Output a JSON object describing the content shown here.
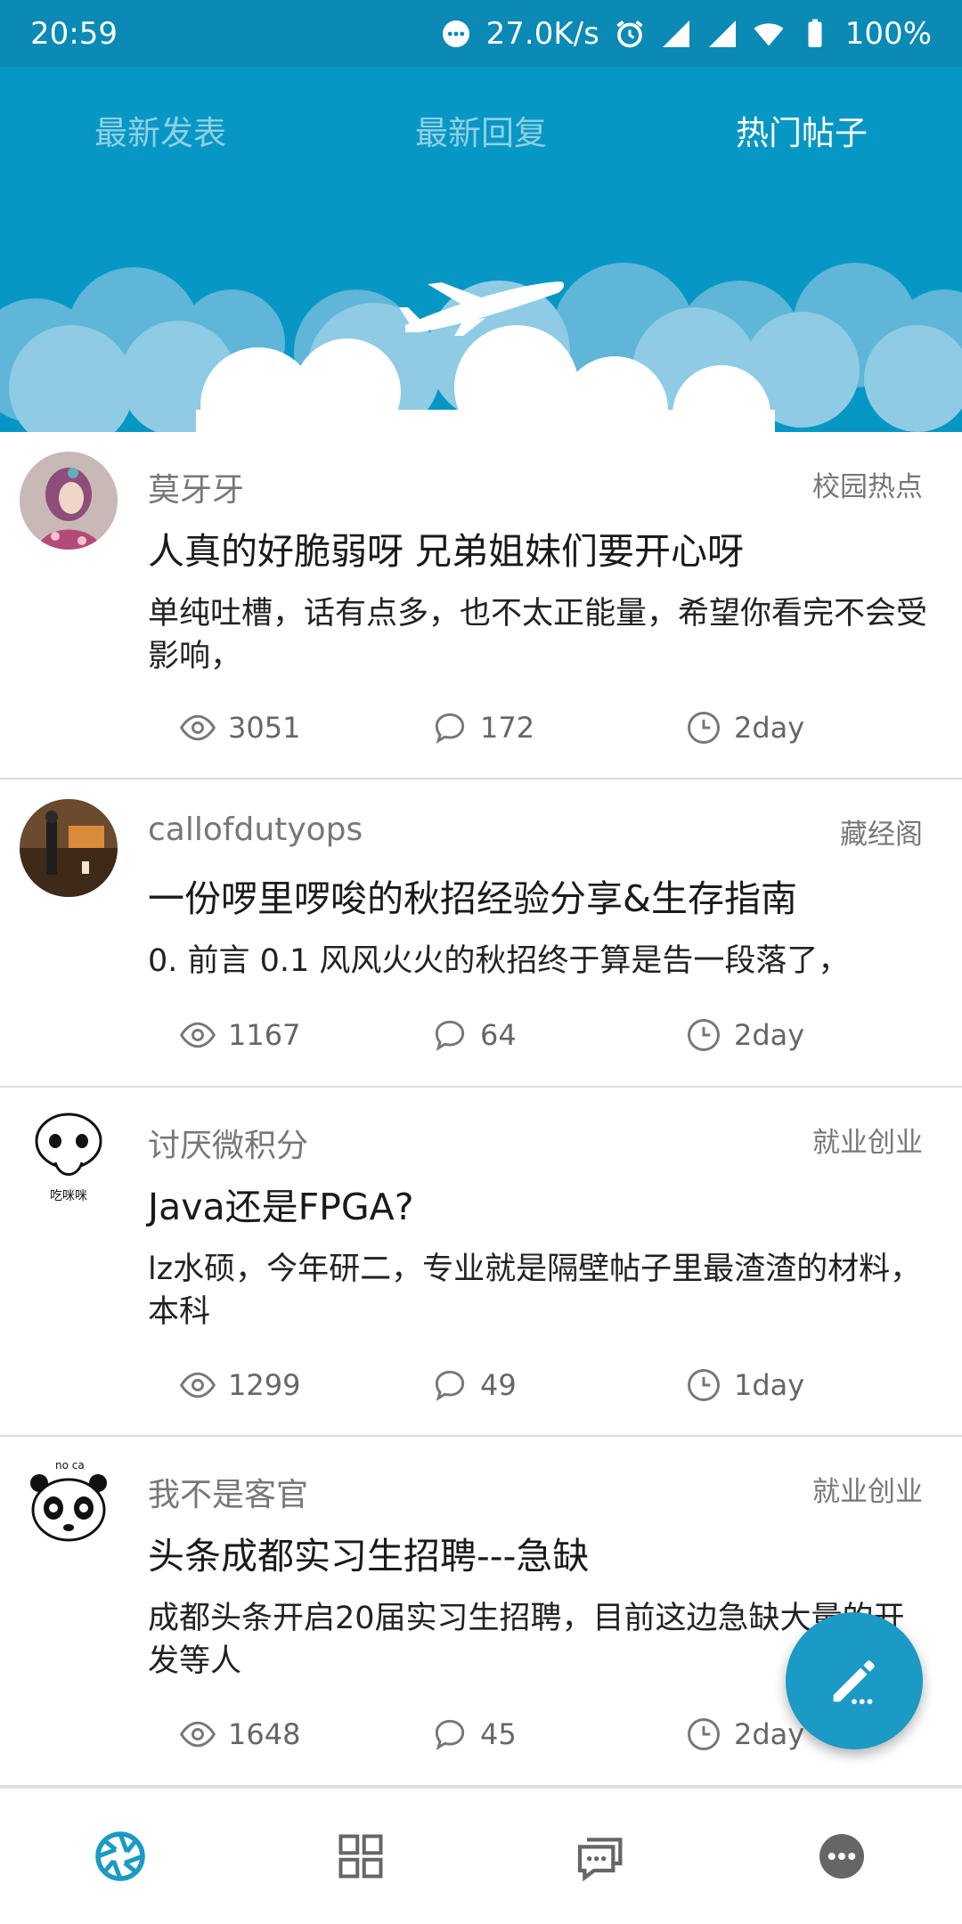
{
  "status_bar": {
    "time": "20:59",
    "net_speed": "27.0K/s",
    "battery": "100%"
  },
  "tabs": [
    {
      "label": "最新发表",
      "active": false
    },
    {
      "label": "最新回复",
      "active": false
    },
    {
      "label": "热门帖子",
      "active": true
    }
  ],
  "posts": [
    {
      "author": "莫牙牙",
      "forum": "校园热点",
      "title": "人真的好脆弱呀 兄弟姐妹们要开心呀",
      "summary": "单纯吐槽，话有点多，也不太正能量，希望你看完不会受影响，",
      "views": "3051",
      "comments": "172",
      "time": "2day"
    },
    {
      "author": "callofdutyops",
      "forum": "藏经阁",
      "title": "一份啰里啰唆的秋招经验分享&生存指南",
      "summary": "0. 前言  0.1 风风火火的秋招终于算是告一段落了，",
      "views": "1167",
      "comments": "64",
      "time": "2day"
    },
    {
      "author": "讨厌微积分",
      "forum": "就业创业",
      "title": "Java还是FPGA?",
      "summary": "lz水硕，今年研二，专业就是隔壁帖子里最渣渣的材料，本科",
      "views": "1299",
      "comments": "49",
      "time": "1day",
      "avatar_caption": "吃咪咪"
    },
    {
      "author": "我不是客官",
      "forum": "就业创业",
      "title": "头条成都实习生招聘---急缺",
      "summary": "成都头条开启20届实习生招聘，目前这边急缺大量的开发等人",
      "views": "1648",
      "comments": "45",
      "time": "2day",
      "avatar_caption": "no ca"
    }
  ],
  "icons": {
    "fab": "edit-icon",
    "nav": [
      "aperture-icon",
      "grid-icon",
      "chat-icon",
      "more-icon"
    ]
  },
  "colors": {
    "header": "#0797c4",
    "status_bar": "#0a8ab4",
    "accent": "#1a9ac4"
  }
}
